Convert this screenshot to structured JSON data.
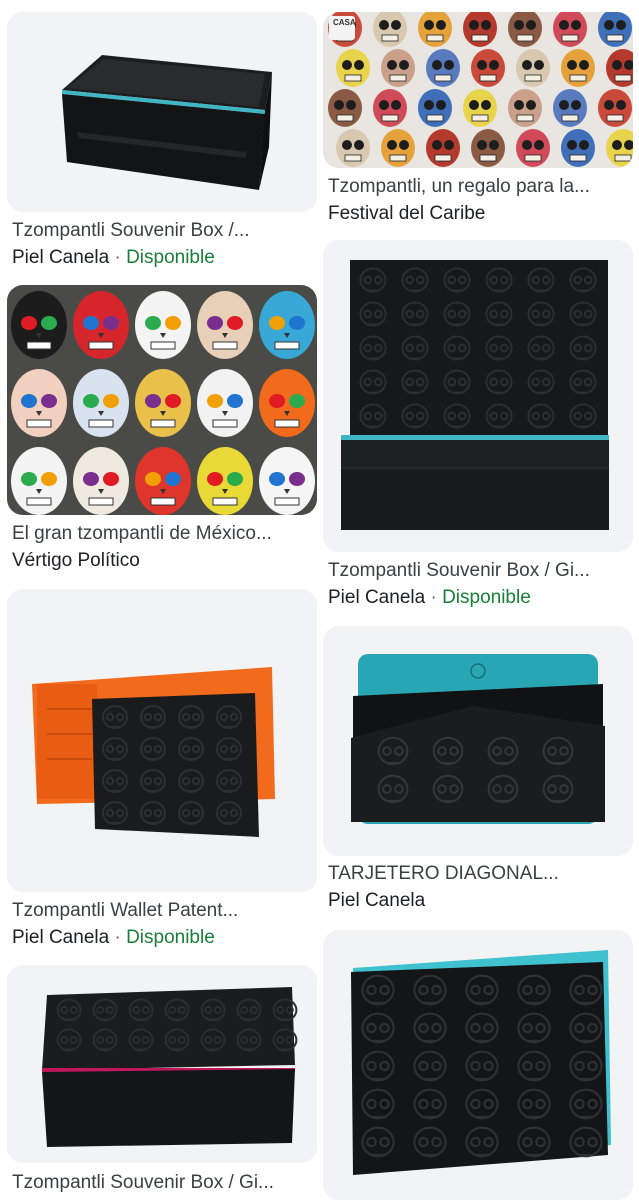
{
  "results": [
    {
      "title": "Tzompantli Souvenir Box /...",
      "source": "Piel Canela",
      "availability": "Disponible",
      "image": "black-patent-box-teal-trim"
    },
    {
      "title": "Tzompantli, un regalo para la...",
      "source": "Festival del Caribe",
      "availability": "",
      "image": "painted-skulls-wall",
      "watermark": "CASA"
    },
    {
      "title": "El gran tzompantli de México...",
      "source": "Vértigo Político",
      "availability": "",
      "image": "colorful-sugar-skulls"
    },
    {
      "title": "Tzompantli Souvenir Box / Gi...",
      "source": "Piel Canela",
      "availability": "Disponible",
      "image": "embossed-skull-box-open"
    },
    {
      "title": "Tzompantli Wallet Patent...",
      "source": "Piel Canela",
      "availability": "Disponible",
      "image": "black-wallet-orange-interior"
    },
    {
      "title": "TARJETERO DIAGONAL...",
      "source": "Piel Canela",
      "availability": "",
      "image": "skull-card-holder-teal"
    },
    {
      "title": "Tzompantli Souvenir Box / Gi...",
      "source": "",
      "availability": "",
      "image": "embossed-skull-box-pink-trim"
    },
    {
      "title": "",
      "source": "",
      "availability": "",
      "image": "embossed-skull-wallet-teal"
    }
  ],
  "separator": "·",
  "colors": {
    "available": "#188038",
    "tile_bg": "#f1f3f4",
    "teal": "#3fb6c4",
    "orange": "#f26a1b"
  }
}
